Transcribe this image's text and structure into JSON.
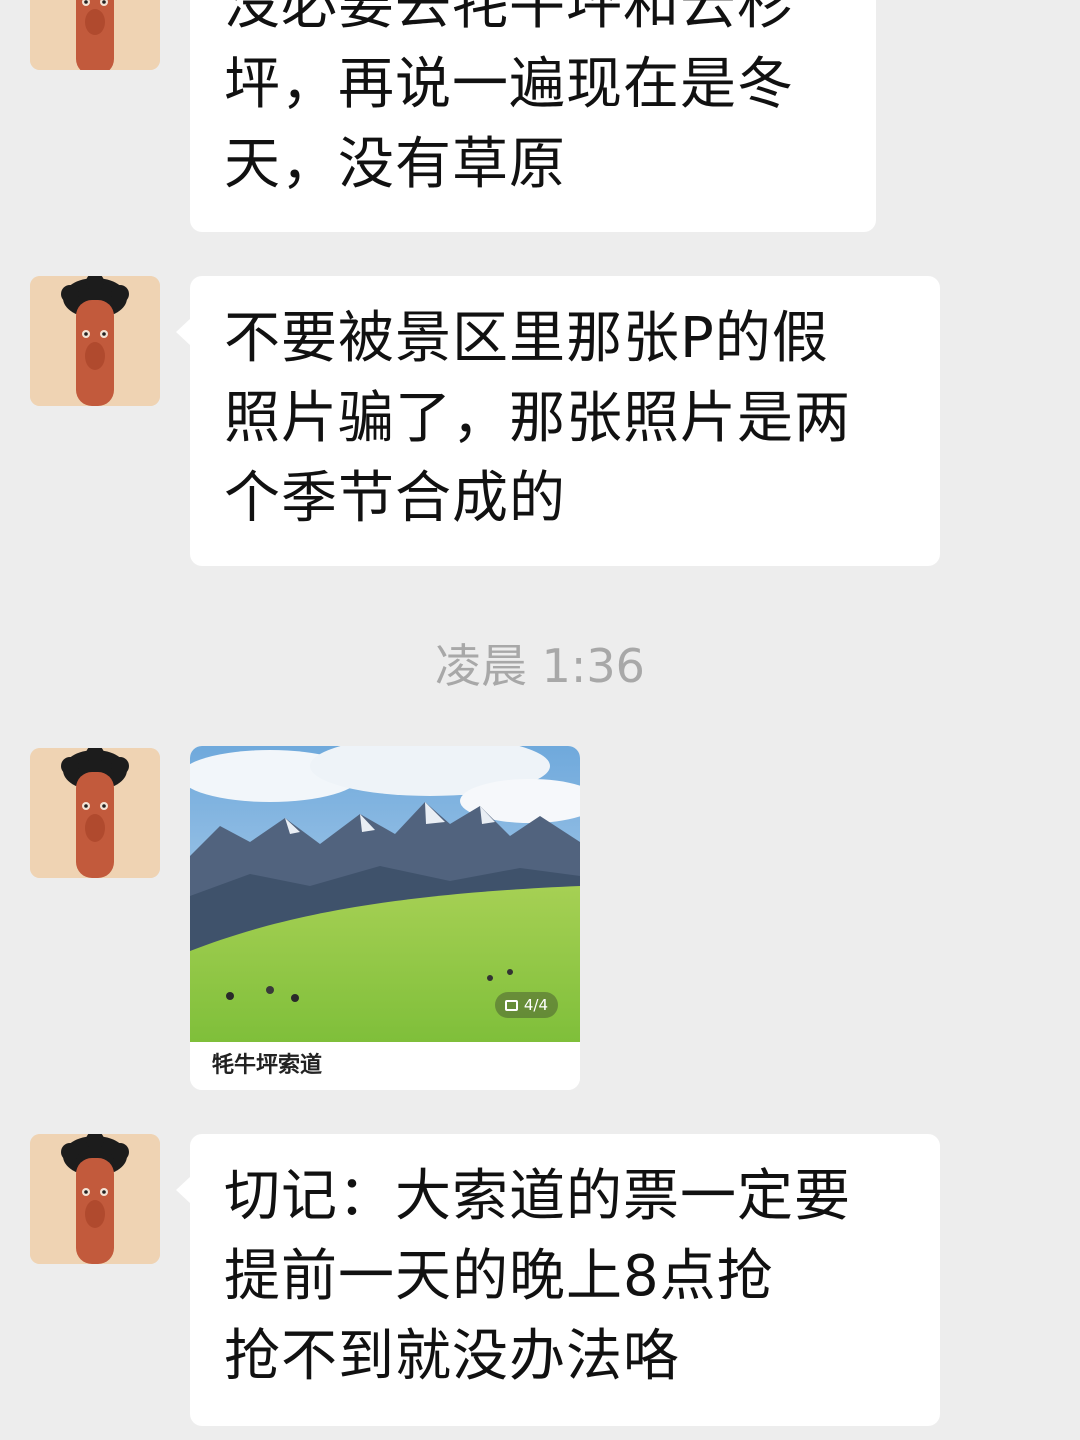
{
  "messages": [
    {
      "lines": [
        "没必要去牦牛坪和云杉",
        "坪，再说一遍现在是冬",
        "天，没有草原"
      ]
    },
    {
      "lines": [
        "不要被景区里那张P的假",
        "照片骗了，那张照片是两",
        "个季节合成的"
      ]
    },
    {
      "lines": [
        "切记：大索道的票一定要",
        "提前一天的晚上8点抢",
        "抢不到就没办法咯"
      ]
    }
  ],
  "timestamp": "凌晨 1:36",
  "card": {
    "title": "牦牛坪索道",
    "counter": "4/4"
  },
  "colors": {
    "background": "#ededed",
    "bubble": "#ffffff",
    "text": "#111111",
    "timestamp": "#a8a8a8"
  },
  "icons": [
    "avatar",
    "gallery-icon"
  ]
}
